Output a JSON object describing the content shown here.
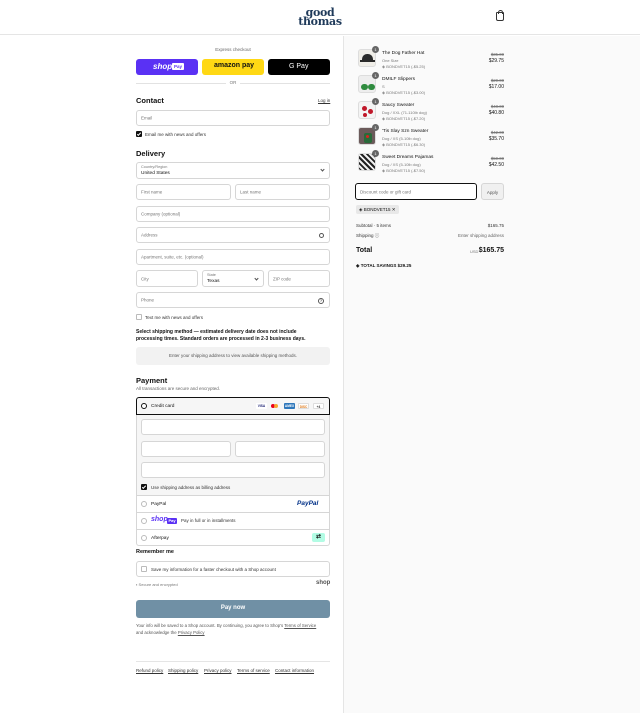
{
  "header": {
    "logo_line1": "good",
    "logo_line2": "thomas"
  },
  "express": {
    "title": "Express checkout",
    "shop_pay": "shop",
    "shop_pay_badge": "Pay",
    "amazon_pay": "amazon pay",
    "gpay": "G Pay",
    "or": "OR"
  },
  "contact": {
    "heading": "Contact",
    "login": "Log in",
    "email_placeholder": "Email",
    "newsletter": "Email me with news and offers"
  },
  "delivery": {
    "heading": "Delivery",
    "country_label": "Country/Region",
    "country_value": "United States",
    "first_name": "First name",
    "last_name": "Last name",
    "company": "Company (optional)",
    "address": "Address",
    "apartment": "Apartment, suite, etc. (optional)",
    "city": "City",
    "state_label": "State",
    "state_value": "Texas",
    "zip": "ZIP code",
    "phone": "Phone",
    "text_offers": "Text me with news and offers"
  },
  "shipping": {
    "notice_line1": "Select shipping method — estimated delivery date does not include",
    "notice_line2": "processing times. Standard orders are processed in 2-3 business days.",
    "placeholder": "Enter your shipping address to view available shipping methods."
  },
  "payment": {
    "heading": "Payment",
    "subtitle": "All transactions are secure and encrypted.",
    "credit_card": "Credit card",
    "card_brands": [
      "VISA",
      "MC",
      "AMEX",
      "DISC",
      "+4"
    ],
    "billing_same": "Use shipping address as billing address",
    "paypal": "PayPal",
    "paypal_logo": "PayPal",
    "shoppay_logo": "shop",
    "shoppay_badge": "Pay",
    "shoppay_text": "Pay in full or in installments",
    "afterpay": "Afterpay"
  },
  "remember": {
    "heading": "Remember me",
    "save_info": "Save my information for a faster checkout with a Shop account",
    "secure": "Secure and encrypted",
    "shop": "shop"
  },
  "pay_button": "Pay now",
  "legal": {
    "line1": "Your info will be saved to a Shop account. By continuing, you agree to Shop's",
    "terms": "Terms of Service",
    "line2": "and acknowledge the",
    "privacy": "Privacy Policy"
  },
  "footer_links": [
    "Refund policy",
    "Shipping policy",
    "Privacy policy",
    "Terms of service",
    "Contact information"
  ],
  "cart": {
    "items": [
      {
        "qty": "1",
        "name": "The Dog Father Hat",
        "variant": "One Size",
        "code": "BONDVET15 (-$5.25)",
        "old_price": "$35.00",
        "price": "$29.75"
      },
      {
        "qty": "1",
        "name": "DMILF Slippers",
        "variant": "S",
        "code": "BONDVET15 (-$3.00)",
        "old_price": "$20.00",
        "price": "$17.00"
      },
      {
        "qty": "1",
        "name": "Saucy Sweater",
        "variant": "Dog / XXL (71-110lb dog)",
        "code": "BONDVET15 (-$7.20)",
        "old_price": "$48.00",
        "price": "$40.80"
      },
      {
        "qty": "1",
        "name": "'Tis Slay Szn Sweater",
        "variant": "Dog / XS (5-10lb dog)",
        "code": "BONDVET15 (-$6.30)",
        "old_price": "$42.00",
        "price": "$35.70"
      },
      {
        "qty": "1",
        "name": "Sweet Dreams Pajamas",
        "variant": "Dog / XS (5-10lb dog)",
        "code": "BONDVET15 (-$7.50)",
        "old_price": "$50.00",
        "price": "$42.50"
      }
    ],
    "discount_placeholder": "Discount code or gift card",
    "apply": "Apply",
    "applied_code": "BONDVET15",
    "subtotal_label": "Subtotal · 5 items",
    "subtotal": "$165.75",
    "shipping_label": "Shipping",
    "shipping_value": "Enter shipping address",
    "total_label": "Total",
    "currency": "USD",
    "total": "$165.75",
    "savings_label": "TOTAL SAVINGS",
    "savings": "$29.25"
  }
}
